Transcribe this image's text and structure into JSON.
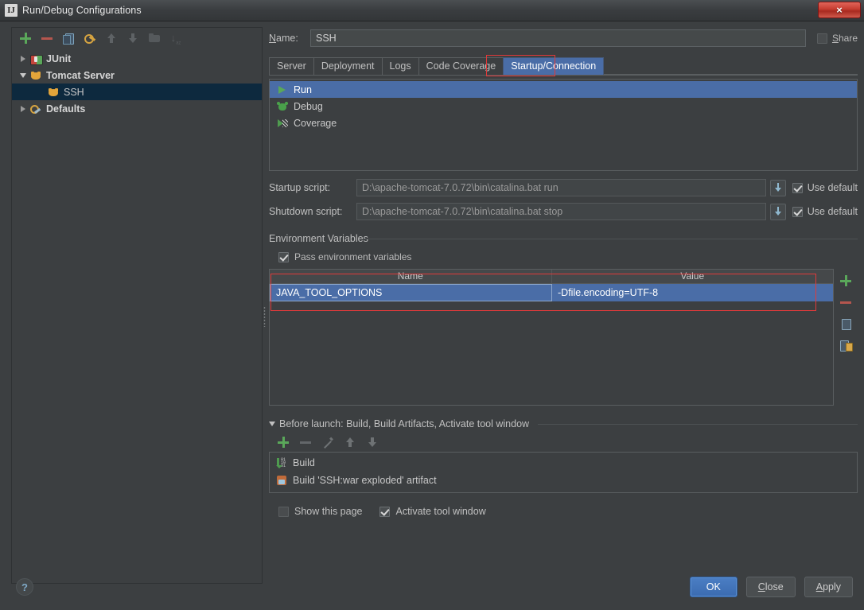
{
  "window": {
    "title": "Run/Debug Configurations",
    "app_icon": "IJ",
    "close_label": "×"
  },
  "tree_toolbar": {
    "buttons": [
      {
        "name": "add-configuration-button",
        "icon": "plus-icon"
      },
      {
        "name": "remove-configuration-button",
        "icon": "minus-icon"
      },
      {
        "name": "copy-configuration-button",
        "icon": "copy-icon"
      },
      {
        "name": "edit-defaults-button",
        "icon": "wrench-icon"
      },
      {
        "name": "move-up-button",
        "icon": "arrow-up-icon"
      },
      {
        "name": "move-down-button",
        "icon": "arrow-down-icon"
      },
      {
        "name": "create-folder-button",
        "icon": "folder-icon"
      },
      {
        "name": "sort-configurations-button",
        "icon": "sort-alpha-icon"
      }
    ]
  },
  "tree": {
    "nodes": [
      {
        "label": "JUnit",
        "icon": "junit-icon",
        "expanded": false,
        "selected": false,
        "indent": 0,
        "bold": true
      },
      {
        "label": "Tomcat Server",
        "icon": "tomcat-icon",
        "expanded": true,
        "selected": false,
        "indent": 0,
        "bold": true
      },
      {
        "label": "SSH",
        "icon": "tomcat-icon",
        "expanded": null,
        "selected": true,
        "indent": 1,
        "bold": false
      },
      {
        "label": "Defaults",
        "icon": "defaults-icon",
        "expanded": false,
        "selected": false,
        "indent": 0,
        "bold": true
      }
    ]
  },
  "name_field": {
    "label": "Name:",
    "label_mnemonic": "N",
    "value": "SSH",
    "placeholder": ""
  },
  "share": {
    "label": "Share",
    "label_mnemonic": "S",
    "checked": false
  },
  "tabs": {
    "items": [
      {
        "label": "Server",
        "active": false
      },
      {
        "label": "Deployment",
        "active": false
      },
      {
        "label": "Logs",
        "active": false
      },
      {
        "label": "Code Coverage",
        "active": false
      },
      {
        "label": "Startup/Connection",
        "active": true
      }
    ]
  },
  "run_modes": {
    "items": [
      {
        "label": "Run",
        "icon": "run-icon",
        "selected": true
      },
      {
        "label": "Debug",
        "icon": "debug-icon",
        "selected": false
      },
      {
        "label": "Coverage",
        "icon": "coverage-icon",
        "selected": false
      }
    ]
  },
  "scripts": {
    "startup": {
      "label": "Startup script:",
      "value": "D:\\apache-tomcat-7.0.72\\bin\\catalina.bat run",
      "browse_icon": "browse-icon",
      "use_default_label": "Use default",
      "use_default_checked": true
    },
    "shutdown": {
      "label": "Shutdown script:",
      "value": "D:\\apache-tomcat-7.0.72\\bin\\catalina.bat stop",
      "browse_icon": "browse-icon",
      "use_default_label": "Use default",
      "use_default_checked": true
    }
  },
  "environment": {
    "section_title": "Environment Variables",
    "pass_env_label": "Pass environment variables",
    "pass_env_checked": true,
    "columns": [
      "Name",
      "Value"
    ],
    "rows": [
      {
        "name": "JAVA_TOOL_OPTIONS",
        "value": "-Dfile.encoding=UTF-8",
        "selected": true
      }
    ],
    "side_buttons": [
      {
        "name": "env-add-button",
        "icon": "plus-icon"
      },
      {
        "name": "env-remove-button",
        "icon": "minus-icon"
      },
      {
        "name": "env-copy-button",
        "icon": "copy-icon"
      },
      {
        "name": "env-paste-button",
        "icon": "paste-icon"
      }
    ]
  },
  "before_launch": {
    "title": "Before launch: Build, Build Artifacts, Activate tool window",
    "title_mnemonic": "B",
    "toolbar": [
      {
        "name": "before-launch-add-button",
        "icon": "plus-icon"
      },
      {
        "name": "before-launch-remove-button",
        "icon": "minus-icon"
      },
      {
        "name": "before-launch-edit-button",
        "icon": "pencil-icon"
      },
      {
        "name": "before-launch-move-up-button",
        "icon": "arrow-up-icon"
      },
      {
        "name": "before-launch-move-down-button",
        "icon": "arrow-down-icon"
      }
    ],
    "tasks": [
      {
        "label": "Build",
        "icon": "build-icon"
      },
      {
        "label": "Build 'SSH:war exploded' artifact",
        "icon": "artifact-icon"
      }
    ]
  },
  "bottom_options": {
    "show_this_page": {
      "label": "Show this page",
      "checked": false
    },
    "activate_tool_window": {
      "label": "Activate tool window",
      "checked": true
    }
  },
  "help": {
    "icon": "help-icon",
    "label": "?"
  },
  "dialog_buttons": [
    {
      "name": "ok-button",
      "label": "OK",
      "primary": true,
      "mnemonic": ""
    },
    {
      "name": "close-button",
      "label": "Close",
      "primary": false,
      "mnemonic": "C"
    },
    {
      "name": "apply-button",
      "label": "Apply",
      "primary": false,
      "mnemonic": "A"
    }
  ],
  "colors": {
    "accent_selection": "#4a6da7",
    "tree_selection": "#0d293e",
    "panel_bg": "#3c3f41",
    "annotation_red": "#e03a3a",
    "icon_green": "#5aa85a",
    "icon_red": "#b5564e"
  }
}
